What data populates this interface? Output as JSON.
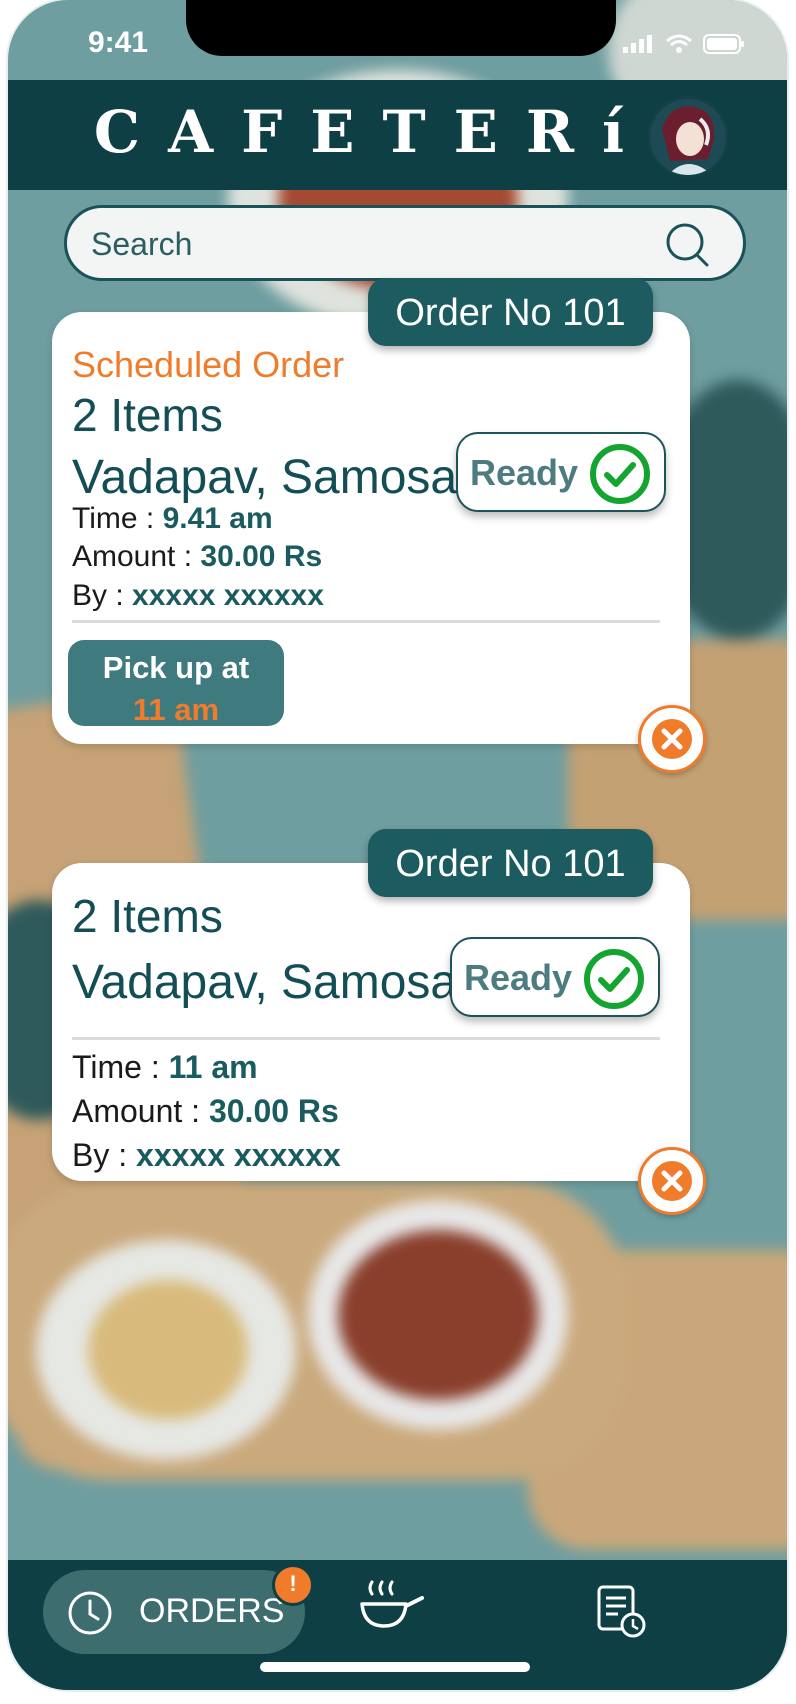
{
  "status_bar": {
    "time": "9:41"
  },
  "header": {
    "brand": "CAFETERíA"
  },
  "search": {
    "placeholder": "Search"
  },
  "orders": [
    {
      "order_no": "Order No 101",
      "tag": "Scheduled Order",
      "items_count": "2 Items",
      "items": "Vadapav, Samosa",
      "status": "Ready",
      "time_label": "Time : ",
      "time": "9.41 am",
      "amount_label": "Amount : ",
      "amount": "30.00 Rs",
      "by_label": "By : ",
      "by": "xxxxx xxxxxx",
      "pickup_label": "Pick up at",
      "pickup_time": "11 am"
    },
    {
      "order_no": "Order No 101",
      "items_count": "2 Items",
      "items": "Vadapav, Samosa",
      "status": "Ready",
      "time_label": "Time : ",
      "time": "11 am",
      "amount_label": "Amount : ",
      "amount": "30.00 Rs",
      "by_label": "By : ",
      "by": "xxxxx xxxxxx"
    }
  ],
  "nav": {
    "orders_label": "ORDERS",
    "badge": "!"
  },
  "colors": {
    "primary_dark": "#0e3f45",
    "accent_orange": "#f07c2b",
    "ready_green": "#14a531"
  }
}
